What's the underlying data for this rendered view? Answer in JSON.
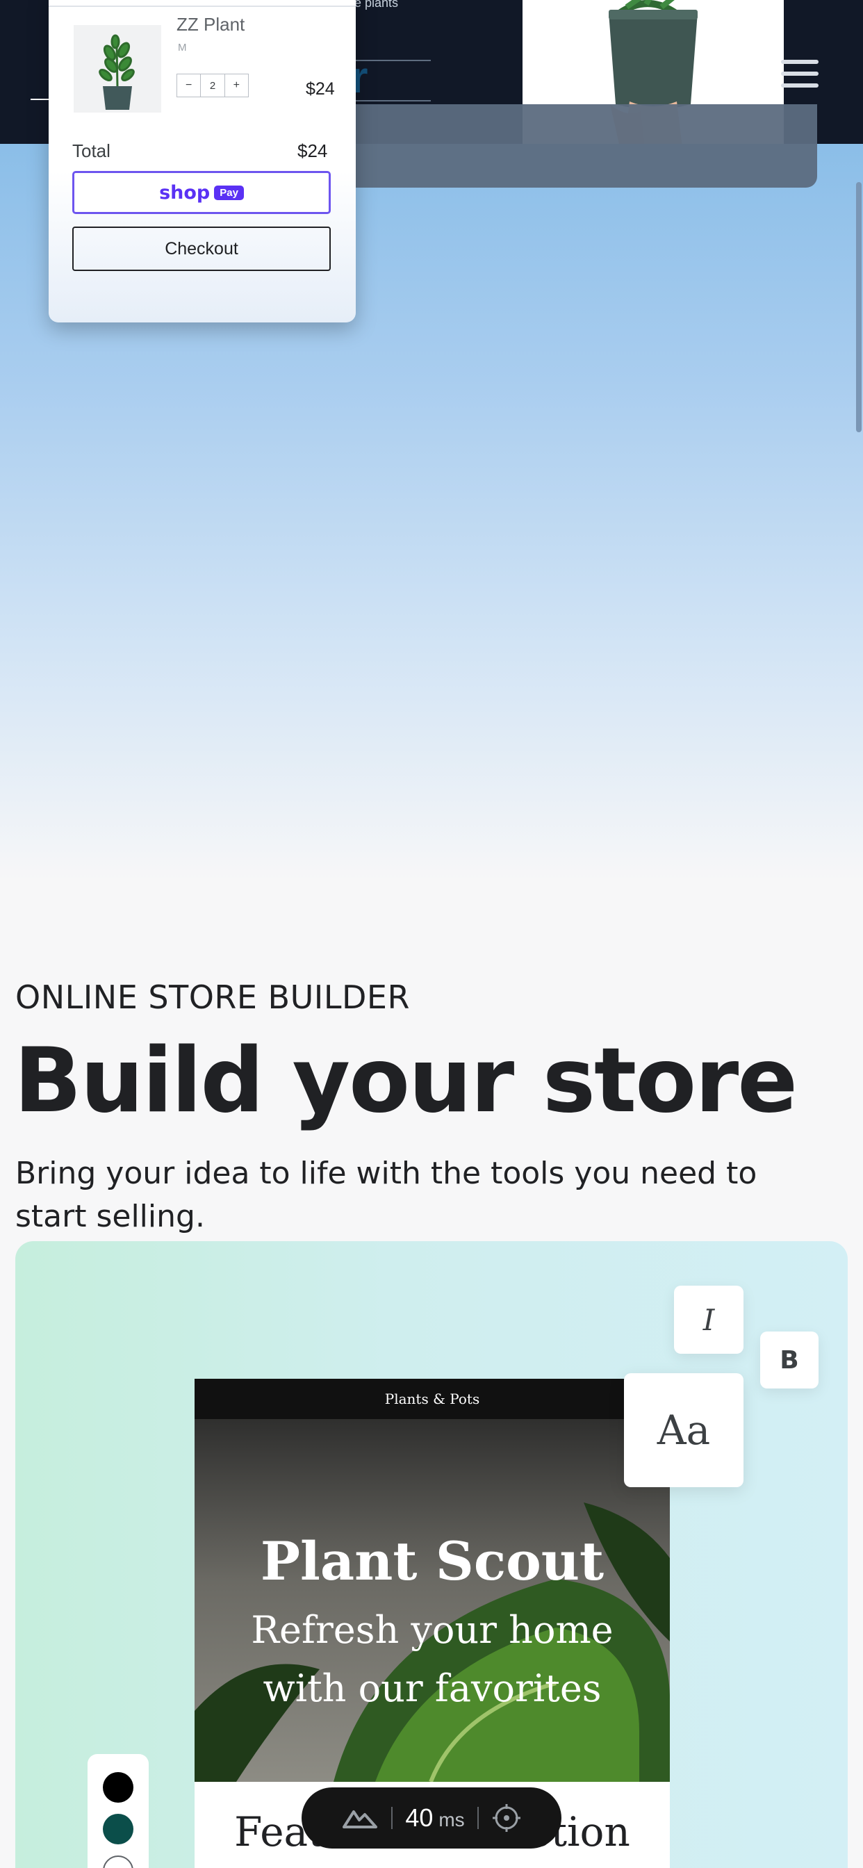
{
  "header": {
    "subtext": "ge plants",
    "brand_fragment": "er"
  },
  "cart": {
    "product_name": "ZZ Plant",
    "variant": "M",
    "qty_minus": "−",
    "quantity": "2",
    "qty_plus": "+",
    "price": "$24",
    "total_label": "Total",
    "total_value": "$24",
    "shoppay_word": "shop",
    "shoppay_badge": "Pay",
    "checkout_label": "Checkout"
  },
  "section": {
    "eyebrow": "ONLINE STORE BUILDER",
    "headline": "Build your store",
    "subheadline": "Bring your idea to life with the tools you need to start selling."
  },
  "editor": {
    "store_topbar": "Plants & Pots",
    "store_title": "Plant Scout",
    "store_subtitle_line1": "Refresh your home",
    "store_subtitle_line2": "with our favorites",
    "featured_heading": "Featured collection",
    "italic_tool": "I",
    "bold_tool": "B",
    "font_tool": "Aa",
    "swatch_colors": [
      "#000000",
      "#0b4e4a",
      "#ffffff"
    ]
  },
  "perf": {
    "value": "40",
    "unit": "ms"
  },
  "colors": {
    "header_bg": "#111827",
    "shoppay_accent": "#5a31f4",
    "text_primary": "#202124"
  }
}
